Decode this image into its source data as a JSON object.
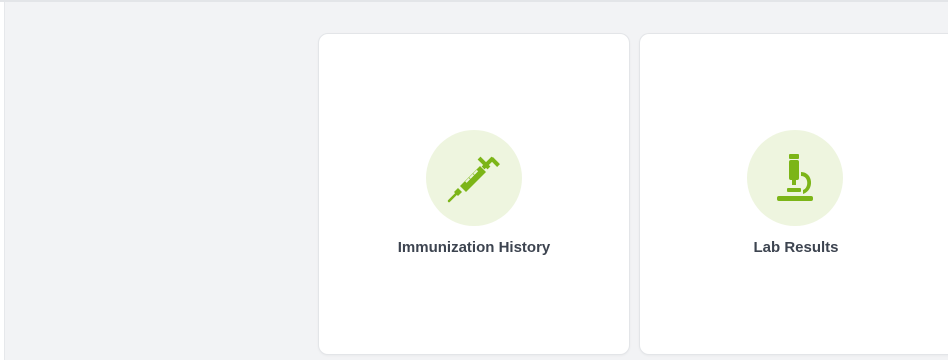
{
  "colors": {
    "background": "#f2f3f5",
    "card_background": "#ffffff",
    "icon_green": "#7cb518",
    "icon_circle": "#eef5df",
    "label_text": "#3d4450"
  },
  "cards": [
    {
      "label": "Immunization History",
      "icon": "syringe-icon"
    },
    {
      "label": "Lab Results",
      "icon": "microscope-icon"
    }
  ]
}
